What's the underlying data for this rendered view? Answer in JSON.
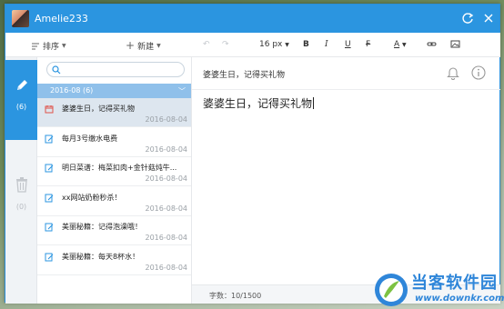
{
  "window": {
    "title": "Amelie233",
    "colors": {
      "accent": "#2b95e0",
      "group_header": "#8fc0ea",
      "selected_row": "#dde6ef"
    }
  },
  "sidebar": {
    "notes": {
      "icon": "pencil-icon",
      "count": "(6)"
    },
    "trash": {
      "icon": "trash-icon",
      "count": "(0)"
    }
  },
  "list_toolbar": {
    "sort_label": "排序",
    "new_label": "新建"
  },
  "search": {
    "placeholder": ""
  },
  "group": {
    "label": "2016-08 (6)"
  },
  "notes": [
    {
      "title": "婆婆生日，记得买礼物",
      "date": "2016-08-04",
      "icon": "alarm-note-icon",
      "selected": true
    },
    {
      "title": "每月3号缴水电费",
      "date": "2016-08-04",
      "icon": "edit-note-icon"
    },
    {
      "title": "明日菜谱：梅菜扣肉+金针菇炖牛...",
      "date": "2016-08-04",
      "icon": "edit-note-icon"
    },
    {
      "title": "xx网站奶粉秒杀！",
      "date": "2016-08-04",
      "icon": "edit-note-icon"
    },
    {
      "title": "美丽秘籍：记得泡澡哦！",
      "date": "2016-08-04",
      "icon": "edit-note-icon"
    },
    {
      "title": "美丽秘籍：每天8杯水！",
      "date": "2016-08-04",
      "icon": "edit-note-icon"
    }
  ],
  "editor_toolbar": {
    "font_size": "16 px",
    "bold": "B",
    "italic": "I",
    "underline": "U",
    "strike": "F",
    "font_color": "A"
  },
  "editor": {
    "title": "婆婆生日，记得买礼物",
    "body": "婆婆生日，记得买礼物",
    "status": "字数：10/1500"
  },
  "watermark": {
    "name": "当客软件园",
    "url": "www.downkr.com"
  }
}
